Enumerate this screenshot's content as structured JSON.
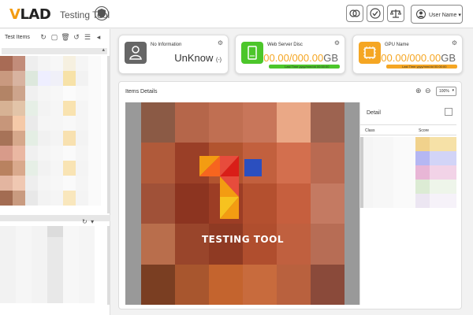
{
  "app": {
    "logo_v": "V",
    "logo_rest": "LAD",
    "title": "Testing Tool"
  },
  "header": {
    "user_name": "User Name ▾",
    "icons": [
      "brain-icon",
      "check-icon",
      "scale-icon"
    ]
  },
  "left_panel": {
    "title": "Test Items",
    "tools": [
      "↻",
      "▢",
      "🗑",
      "↺",
      "☰",
      "◂"
    ],
    "mini_tools": [
      "↻",
      "▾"
    ]
  },
  "cards": [
    {
      "title": "No Information",
      "value": "UnKnow",
      "value_suffix": "(-)",
      "icon": "user-icon",
      "color": "#666666"
    },
    {
      "title": "Web Server Disc",
      "value": "00.00/000.00",
      "value_unit": "GB",
      "bar_label": "Last Time yyyy/mm/dd 00:00:00",
      "icon": "hard-disk-icon",
      "color": "#4cc62a",
      "fill_fraction": 1.0
    },
    {
      "title": "GPU Name",
      "value": "000.00/000.00",
      "value_unit": "GB",
      "bar_label": "Last Time yyyy/mm/dd 00:00:00",
      "icon": "gpu-chip-icon",
      "color": "#f5a623",
      "fill_fraction": 1.0
    }
  ],
  "details": {
    "title": "Items Details",
    "zoom_value": "100%",
    "brand_text": "TESTING TOOL",
    "pane_title": "Detail",
    "col_class": "Class",
    "col_score": "Score"
  },
  "colors": {
    "accent_orange": "#f39c12",
    "green": "#4cc62a",
    "amber": "#f5a623",
    "gray_icon": "#666666"
  }
}
